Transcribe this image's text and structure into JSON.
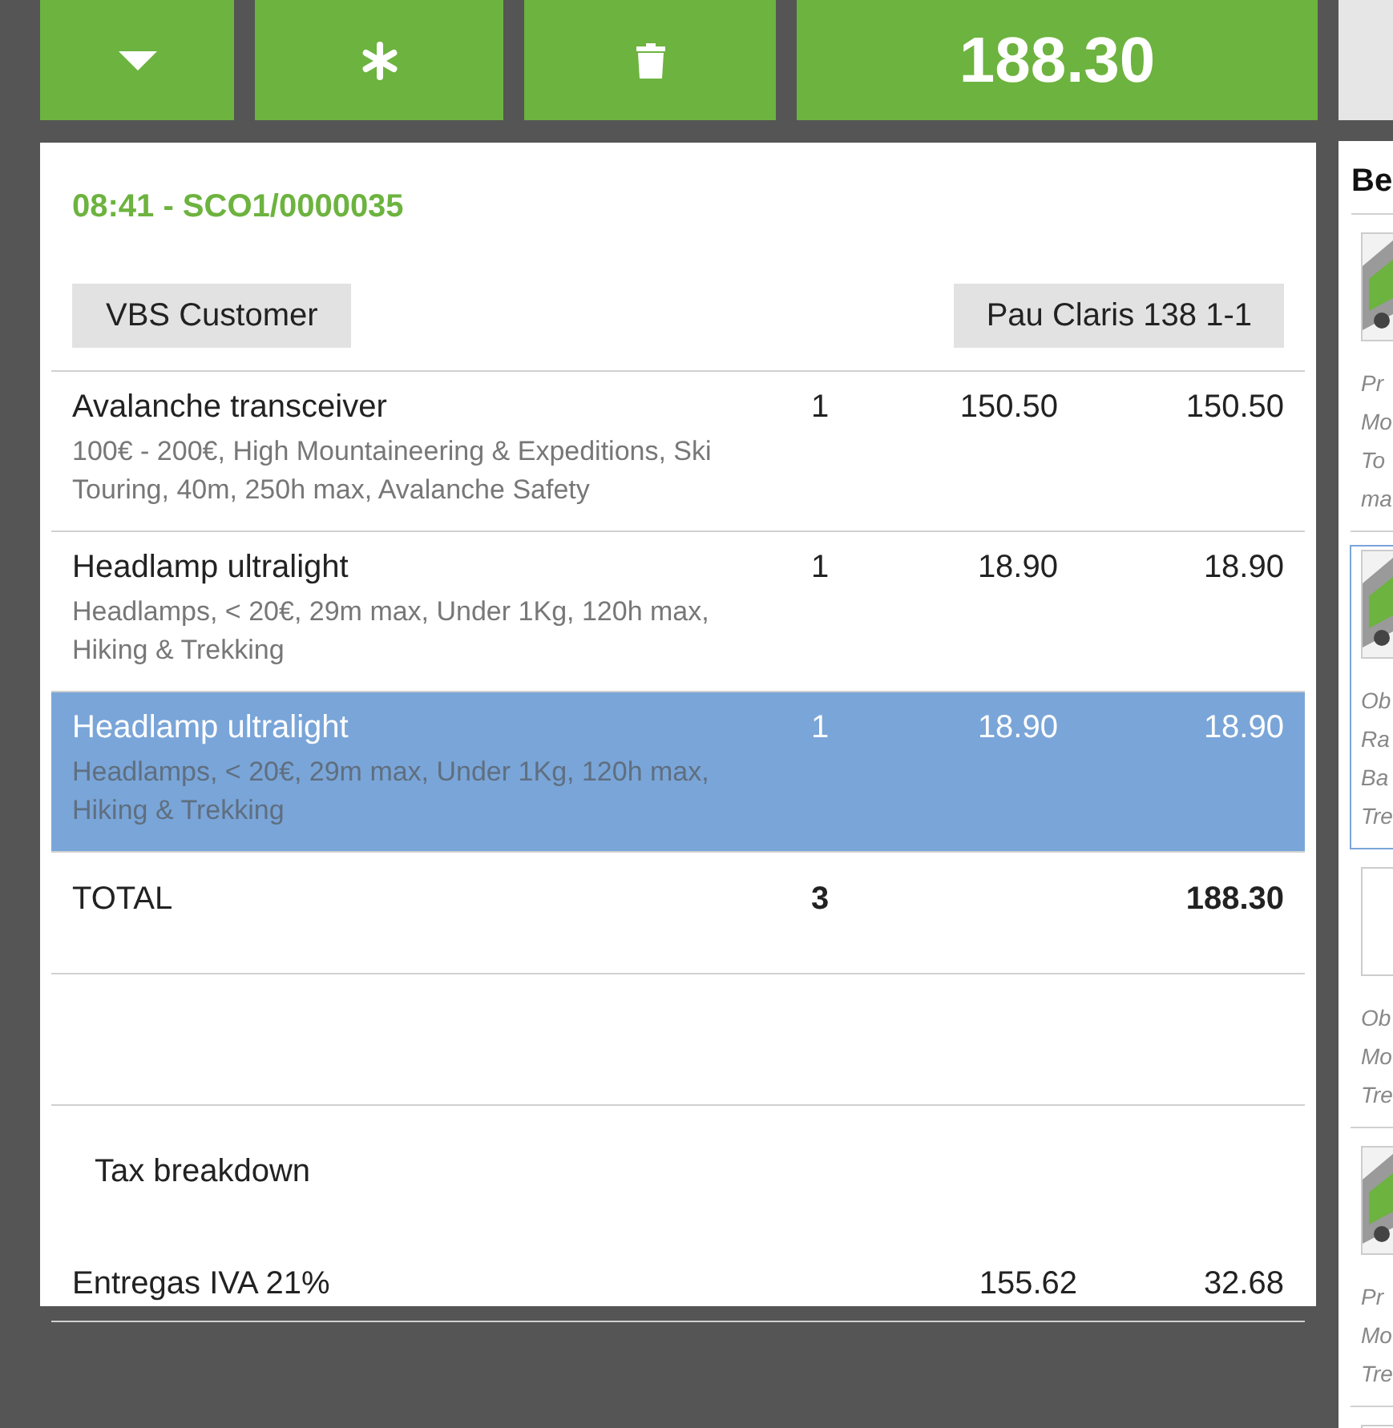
{
  "toolbar": {
    "buttons": [
      {
        "kind": "menu"
      },
      {
        "kind": "asterisk"
      },
      {
        "kind": "delete"
      }
    ],
    "total": "188.30"
  },
  "receipt": {
    "header": "08:41 - SCO1/0000035",
    "customer": "VBS Customer",
    "location": "Pau Claris 138 1-1",
    "lines": [
      {
        "name": "Avalanche transceiver",
        "attributes": "100€ - 200€, High Mountaineering & Expeditions, Ski Touring, 40m, 250h max, Avalanche Safety",
        "qty": "1",
        "price": "150.50",
        "total": "150.50",
        "selected": false
      },
      {
        "name": "Headlamp ultralight",
        "attributes": "Headlamps, < 20€, 29m max, Under 1Kg, 120h max, Hiking & Trekking",
        "qty": "1",
        "price": "18.90",
        "total": "18.90",
        "selected": false
      },
      {
        "name": "Headlamp ultralight",
        "attributes": "Headlamps, < 20€, 29m max, Under 1Kg, 120h max, Hiking & Trekking",
        "qty": "1",
        "price": "18.90",
        "total": "18.90",
        "selected": true
      }
    ],
    "total": {
      "label": "TOTAL",
      "qty": "3",
      "amount": "188.30"
    },
    "tax": {
      "title": "Tax breakdown",
      "rows": [
        {
          "name": "Entregas IVA 21%",
          "base": "155.62",
          "amount": "32.68"
        }
      ]
    }
  },
  "side_panel": {
    "title": "Be",
    "products": [
      {
        "kind": "picture",
        "lines": [
          "Pr",
          "Mo",
          "To",
          "ma"
        ],
        "selected": false
      },
      {
        "kind": "picture",
        "lines": [
          "Ob",
          "Ra",
          "Ba",
          "Tre"
        ],
        "selected": true
      },
      {
        "lines": [
          "Ob",
          "Mo",
          "Tre"
        ],
        "selected": false
      },
      {
        "kind": "picture",
        "lines": [
          "Pr",
          "Mo",
          "Tre"
        ],
        "selected": false
      },
      {
        "selected": false
      }
    ]
  }
}
